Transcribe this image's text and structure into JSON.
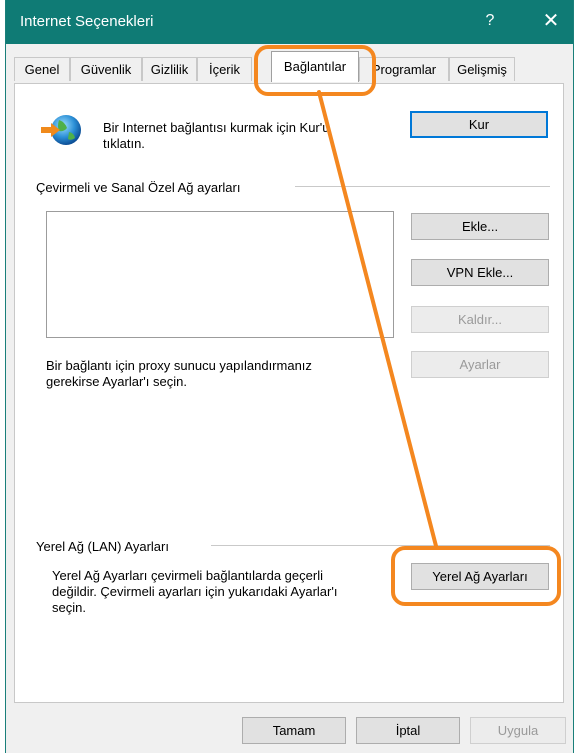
{
  "window": {
    "title": "Internet Seçenekleri",
    "help_label": "?",
    "close_label": "✕"
  },
  "tabs": [
    {
      "label": "Genel"
    },
    {
      "label": "Güvenlik"
    },
    {
      "label": "Gizlilik"
    },
    {
      "label": "İçerik"
    },
    {
      "label": "Bağlantılar"
    },
    {
      "label": "Programlar"
    },
    {
      "label": "Gelişmiş"
    }
  ],
  "setup": {
    "text_line1": "Bir Internet bağlantısı kurmak için Kur'u",
    "text_line2": "tıklatın.",
    "button": "Kur"
  },
  "dialup": {
    "section_title": "Çevirmeli ve Sanal Özel Ağ ayarları",
    "add_button": "Ekle...",
    "add_vpn_button": "VPN Ekle...",
    "remove_button": "Kaldır...",
    "settings_button": "Ayarlar",
    "proxy_line1": "Bir bağlantı için proxy sunucu yapılandırmanız",
    "proxy_line2": "gerekirse Ayarlar'ı seçin."
  },
  "lan": {
    "section_title": "Yerel Ağ (LAN) Ayarları",
    "text_line1": "Yerel Ağ Ayarları çevirmeli bağlantılarda geçerli",
    "text_line2": "değildir. Çevirmeli ayarları için yukarıdaki Ayarlar'ı",
    "text_line3": "seçin.",
    "button": "Yerel Ağ Ayarları"
  },
  "footer": {
    "ok": "Tamam",
    "cancel": "İptal",
    "apply": "Uygula"
  },
  "colors": {
    "titlebar": "#0f7b75",
    "highlight": "#f4871f",
    "accent": "#0078d7"
  }
}
